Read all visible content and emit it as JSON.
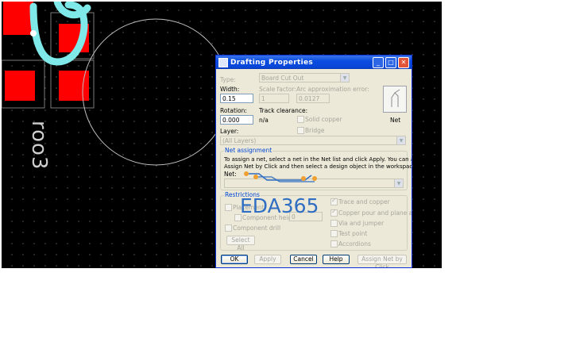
{
  "pcb": {
    "silkscreen_text": "roo3"
  },
  "dialog": {
    "title": "Drafting Properties",
    "type_label": "Type:",
    "type_value": "Board Cut Out",
    "width_label": "Width:",
    "width_value": "0.15",
    "scale_label": "Scale factor:",
    "scale_value": "1",
    "arc_label": "Arc approximation error:",
    "arc_value": "0.0127",
    "rotation_label": "Rotation:",
    "rotation_value": "0.000",
    "track_clearance_label": "Track clearance:",
    "track_clearance_value": "n/a",
    "solid_copper_label": "Solid copper",
    "bridge_label": "Bridge",
    "layer_label": "Layer:",
    "layer_value": "(All Layers)",
    "net_button_label": "Net",
    "net_assignment": {
      "title": "Net assignment",
      "description_line1": "To assign a net, select a net in the Net list and click Apply. You can also click",
      "description_line2": "Assign Net by Click and then select a design object in the workspace.",
      "net_label": "Net:"
    },
    "restrictions": {
      "title": "Restrictions",
      "placement": "Placement",
      "component_height": "Component height",
      "component_height_value": "0",
      "component_drill": "Component drill",
      "select_all": "Select All",
      "trace_and_copper": "Trace and copper",
      "copper_pour": "Copper pour and plane area",
      "via_and_jumper": "Via and jumper",
      "test_point": "Test point",
      "accordions": "Accordions"
    },
    "buttons": {
      "ok": "OK",
      "apply": "Apply",
      "cancel": "Cancel",
      "help": "Help",
      "assign_net_by_click": "Assign Net by Click"
    }
  },
  "watermark": "EDA365",
  "colors": {
    "pad_red": "#ff0000",
    "silk_cyan": "#7fe8e8",
    "titlebar_blue": "#0a4ddf",
    "watermark_blue": "#2f6ec2"
  }
}
